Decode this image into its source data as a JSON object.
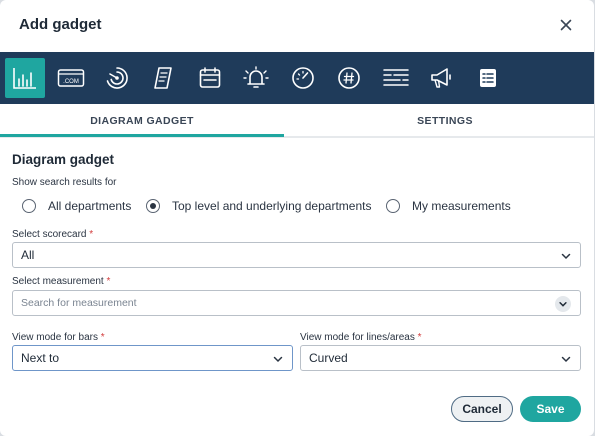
{
  "dialog": {
    "title": "Add gadget"
  },
  "toolbar": {
    "icons": [
      {
        "name": "bar-chart-icon",
        "active": true
      },
      {
        "name": "com-domain-icon"
      },
      {
        "name": "gauge-icon"
      },
      {
        "name": "scroll-document-icon"
      },
      {
        "name": "calendar-icon"
      },
      {
        "name": "alarm-bell-icon"
      },
      {
        "name": "speedometer-icon"
      },
      {
        "name": "hashtag-circle-icon"
      },
      {
        "name": "text-lines-icon"
      },
      {
        "name": "megaphone-icon"
      },
      {
        "name": "checklist-icon"
      }
    ],
    "com_text": ".COM"
  },
  "tabs": [
    {
      "label": "DIAGRAM GADGET",
      "active": true
    },
    {
      "label": "SETTINGS",
      "active": false
    }
  ],
  "form": {
    "section_title": "Diagram gadget",
    "scope_label": "Show search results for",
    "scope_options": [
      {
        "label": "All departments",
        "checked": false
      },
      {
        "label": "Top level and underlying departments",
        "checked": true
      },
      {
        "label": "My measurements",
        "checked": false
      }
    ],
    "scorecard": {
      "label": "Select scorecard",
      "required_mark": "*",
      "value": "All"
    },
    "measurement": {
      "label": "Select measurement",
      "required_mark": "*",
      "placeholder": "Search for measurement"
    },
    "bars_mode": {
      "label": "View mode for bars",
      "required_mark": "*",
      "value": "Next to"
    },
    "lines_mode": {
      "label": "View mode for lines/areas",
      "required_mark": "*",
      "value": "Curved"
    }
  },
  "footer": {
    "cancel_label": "Cancel",
    "save_label": "Save"
  },
  "colors": {
    "toolbar_bg": "#1f3b5a",
    "accent": "#1fa6a0",
    "required": "#d23b3b"
  }
}
